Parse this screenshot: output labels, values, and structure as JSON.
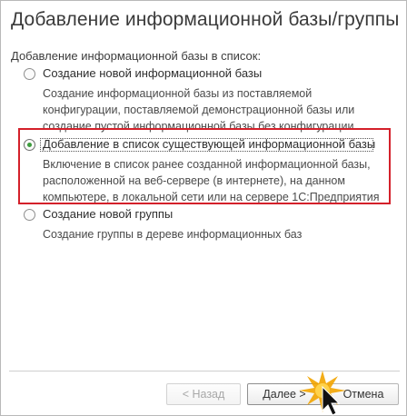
{
  "dialog": {
    "title": "Добавление информационной базы/группы",
    "section_label": "Добавление информационной базы в список:"
  },
  "options": [
    {
      "label": "Создание новой информационной базы",
      "description": [
        "Создание информационной базы из поставляемой",
        "конфигурации, поставляемой демонстрационной базы или",
        "создание пустой информационной базы без конфигурации"
      ],
      "selected": false
    },
    {
      "label": "Добавление в список существующей информационной базы",
      "description": [
        "Включение в список ранее созданной информационной базы,",
        "расположенной на веб-сервере (в интернете), на данном",
        "компьютере,  в локальной сети или на сервере 1С:Предприятия"
      ],
      "selected": true
    },
    {
      "label": "Создание новой группы",
      "description": [
        "Создание группы в дереве информационных баз"
      ],
      "selected": false
    }
  ],
  "buttons": {
    "back": "< Назад",
    "next": "Далее >",
    "cancel": "Отмена"
  },
  "colors": {
    "highlight": "#d4202a",
    "radio_selected": "#3d9c3d",
    "cursor": "#f2a400"
  }
}
